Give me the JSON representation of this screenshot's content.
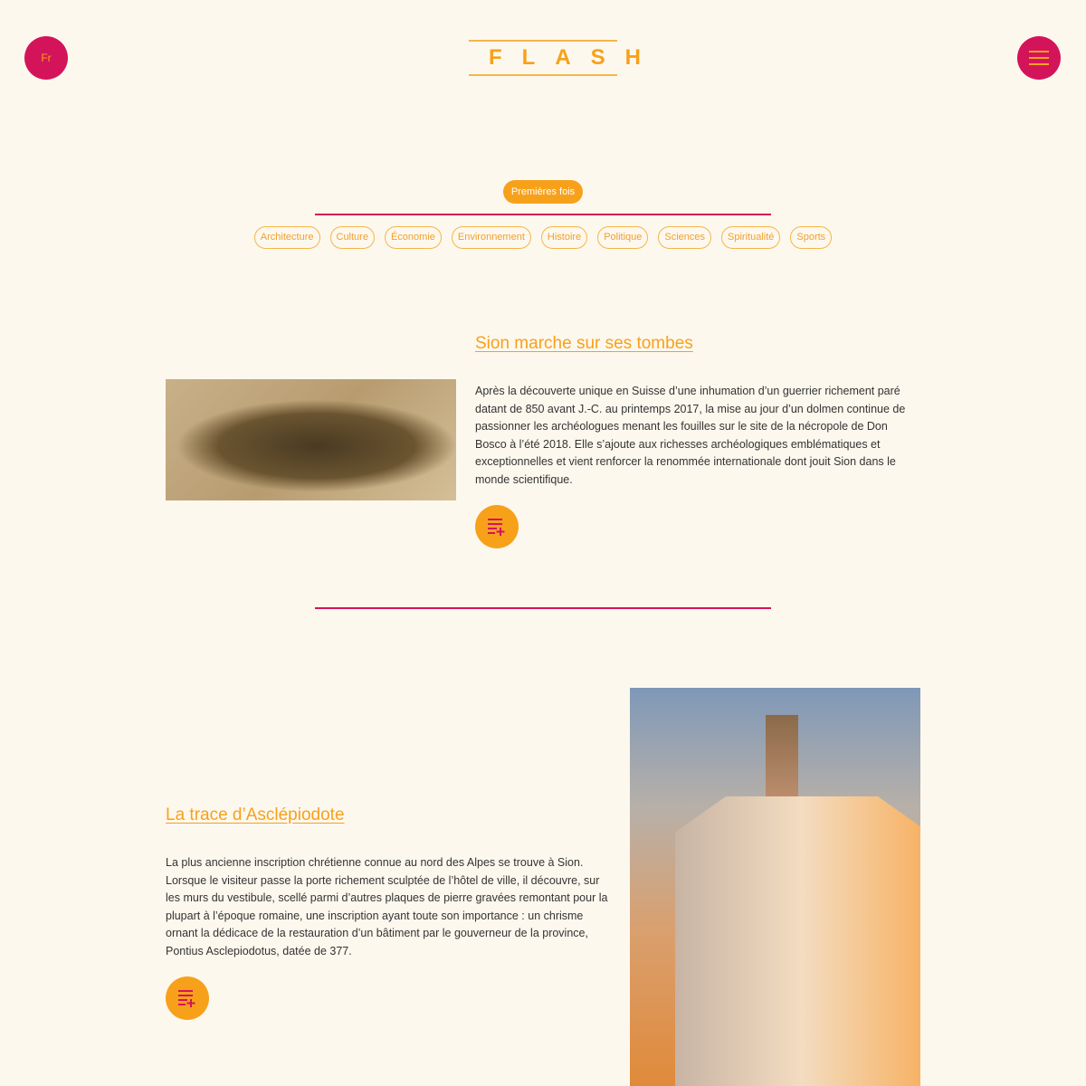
{
  "header": {
    "lang": "Fr",
    "logo": "FLASH",
    "menu_icon": "hamburger-icon"
  },
  "featured_tag": "Premières fois",
  "tags": [
    "Architecture",
    "Culture",
    "Économie",
    "Environnement",
    "Histoire",
    "Politique",
    "Sciences",
    "Spiritualité",
    "Sports"
  ],
  "articles": [
    {
      "title": "Sion marche sur ses tombes",
      "body": "Après la découverte unique en Suisse d’une inhumation d’un guerrier richement paré datant de 850 avant J.-C. au printemps 2017, la mise au jour d’un dolmen continue de passionner les archéologues menant les fouilles sur le site de la nécropole de Don Bosco à l’été 2018. Elle s’ajoute aux richesses archéologiques emblématiques et exceptionnelles et vient renforcer la renommée internationale dont jouit Sion dans le monde scientifique.",
      "icon": "playlist-add-icon"
    },
    {
      "title": "La trace d’Asclépiodote",
      "body": "La plus ancienne inscription chrétienne connue au nord des Alpes se trouve à Sion. Lorsque le visiteur passe la porte richement sculptée de l’hôtel de ville, il découvre, sur les murs du vestibule, scellé parmi d’autres plaques de pierre gravées remontant pour la plupart à l’époque romaine, une inscription ayant toute son importance : un chrisme ornant la dédicace de la restauration d’un bâtiment par le gouverneur de la province, Pontius Asclepiodotus, datée de 377.",
      "icon": "playlist-add-icon"
    }
  ],
  "colors": {
    "background": "#fdf8ee",
    "accent": "#f7a11a",
    "crimson": "#d4145a"
  }
}
